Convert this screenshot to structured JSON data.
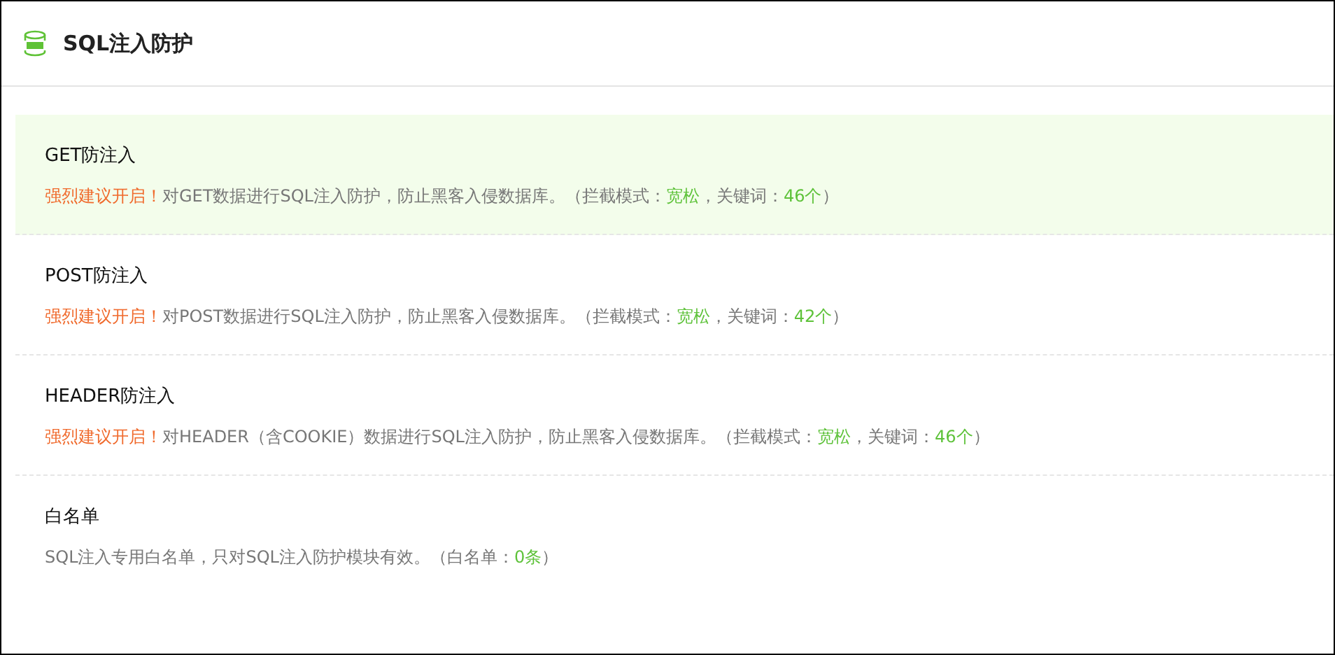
{
  "panel": {
    "title": "SQL注入防护"
  },
  "items": [
    {
      "title": "GET防注入",
      "selected": true,
      "description": [
        {
          "kind": "warn",
          "text": "强烈建议开启！"
        },
        {
          "kind": "plain",
          "text": "对GET数据进行SQL注入防护，防止黑客入侵数据库。（拦截模式："
        },
        {
          "kind": "value",
          "text": "宽松"
        },
        {
          "kind": "plain",
          "text": "，关键词："
        },
        {
          "kind": "value",
          "text": "46个"
        },
        {
          "kind": "plain",
          "text": "）"
        }
      ]
    },
    {
      "title": "POST防注入",
      "selected": false,
      "description": [
        {
          "kind": "warn",
          "text": "强烈建议开启！"
        },
        {
          "kind": "plain",
          "text": "对POST数据进行SQL注入防护，防止黑客入侵数据库。（拦截模式："
        },
        {
          "kind": "value",
          "text": "宽松"
        },
        {
          "kind": "plain",
          "text": "，关键词："
        },
        {
          "kind": "value",
          "text": "42个"
        },
        {
          "kind": "plain",
          "text": "）"
        }
      ]
    },
    {
      "title": "HEADER防注入",
      "selected": false,
      "description": [
        {
          "kind": "warn",
          "text": "强烈建议开启！"
        },
        {
          "kind": "plain",
          "text": "对HEADER（含COOKIE）数据进行SQL注入防护，防止黑客入侵数据库。（拦截模式："
        },
        {
          "kind": "value",
          "text": "宽松"
        },
        {
          "kind": "plain",
          "text": "，关键词："
        },
        {
          "kind": "value",
          "text": "46个"
        },
        {
          "kind": "plain",
          "text": "）"
        }
      ]
    },
    {
      "title": "白名单",
      "selected": false,
      "description": [
        {
          "kind": "plain",
          "text": "SQL注入专用白名单，只对SQL注入防护模块有效。（白名单："
        },
        {
          "kind": "value",
          "text": "0条"
        },
        {
          "kind": "plain",
          "text": "）"
        }
      ]
    }
  ]
}
